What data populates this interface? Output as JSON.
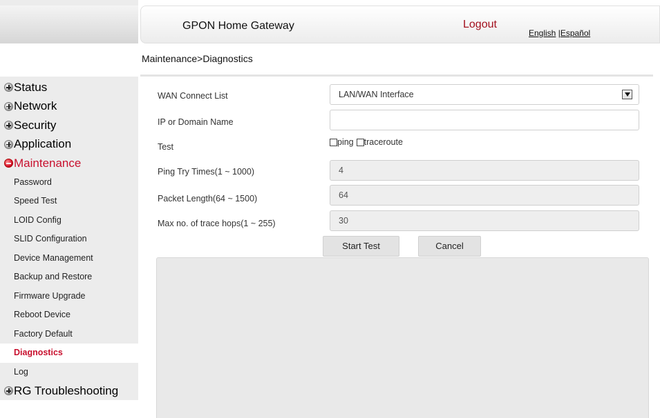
{
  "header": {
    "title": "GPON Home Gateway",
    "logout": "Logout",
    "lang_en": "English",
    "lang_sep": " |",
    "lang_es": "Español"
  },
  "breadcrumb": "Maintenance>Diagnostics",
  "sidebar": {
    "categories_top": [
      {
        "label": "Status",
        "icon": "plus-bullet-icon"
      },
      {
        "label": "Network",
        "icon": "plus-bullet-icon"
      },
      {
        "label": "Security",
        "icon": "plus-bullet-icon"
      },
      {
        "label": "Application",
        "icon": "plus-bullet-icon"
      }
    ],
    "active_category": {
      "label": "Maintenance",
      "icon": "minus-bullet-icon",
      "color": "#c8102e"
    },
    "sub_items": [
      "Password",
      "Speed Test",
      "LOID Config",
      "SLID Configuration",
      "Device Management",
      "Backup and Restore",
      "Firmware Upgrade",
      "Reboot Device",
      "Factory Default",
      "Diagnostics",
      "Log"
    ],
    "selected_sub": "Diagnostics",
    "category_bottom": {
      "label": "RG Troubleshooting",
      "icon": "plus-bullet-icon"
    }
  },
  "form": {
    "wan_label": "WAN Connect List",
    "wan_value": "LAN/WAN Interface",
    "ip_label": "IP or Domain Name",
    "ip_value": "",
    "test_label": "Test",
    "opt_ping": "ping",
    "opt_traceroute": "traceroute",
    "ping_label": "Ping Try Times(1 ~ 1000)",
    "ping_value": "4",
    "packet_label": "Packet Length(64 ~ 1500)",
    "packet_value": "64",
    "hops_label": "Max no. of trace hops(1 ~ 255)",
    "hops_value": "30",
    "start_button": "Start Test",
    "cancel_button": "Cancel"
  },
  "colors": {
    "accent_red": "#c8102e",
    "logout_red": "#a30f1d"
  }
}
